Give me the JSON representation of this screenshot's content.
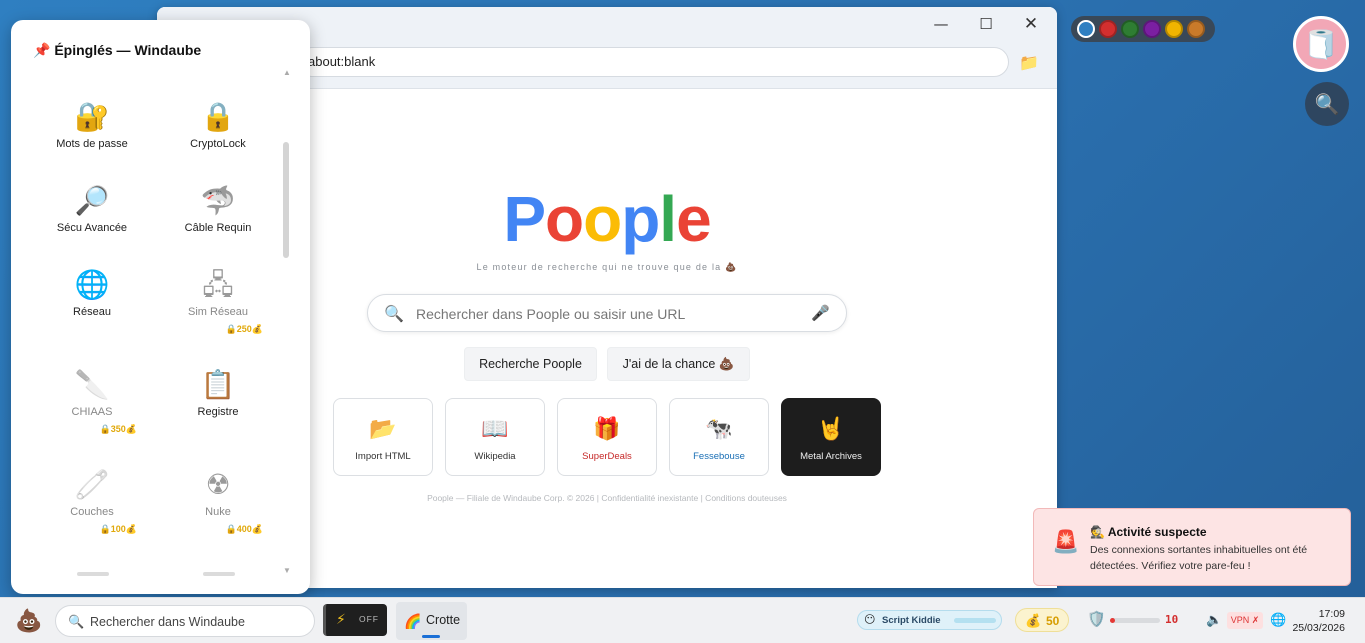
{
  "browser": {
    "address": "about:blank",
    "window_controls": {
      "minimize": "—",
      "maximize": "☐",
      "close": "✕"
    },
    "logo_letters": [
      "P",
      "o",
      "o",
      "p",
      "l",
      "e"
    ],
    "tagline": "Le moteur de recherche qui ne trouve que de la 💩",
    "search_placeholder": "Rechercher dans Poople ou saisir une URL",
    "buttons": {
      "search": "Recherche Poople",
      "lucky": "J'ai de la chance 💩"
    },
    "tiles": [
      {
        "label": "Import HTML",
        "icon": "📂",
        "icon_name": "folder-icon",
        "color": "#333333"
      },
      {
        "label": "Wikipedia",
        "icon": "📖",
        "icon_name": "book-icon",
        "color": "#333333"
      },
      {
        "label": "SuperDeals",
        "icon": "🎁",
        "icon_name": "gift-icon",
        "color": "#c62828"
      },
      {
        "label": "Fessebouse",
        "icon": "🐄",
        "icon_name": "cow-icon",
        "color": "#1a6fb5"
      },
      {
        "label": "Metal Archives",
        "icon": "🤘",
        "icon_name": "metal-hand-icon",
        "color": "#eeeeee"
      }
    ],
    "footer": "Poople — Filiale de Windaube Corp. © 2026 | Confidentialité inexistante | Conditions douteuses"
  },
  "pinned": {
    "title": "📌 Épinglés — Windaube",
    "apps": [
      {
        "label": "Mots de passe",
        "icon": "🔐",
        "icon_name": "lock-key-icon",
        "locked": false,
        "price": ""
      },
      {
        "label": "CryptoLock",
        "icon": "🔒",
        "icon_name": "padlock-icon",
        "locked": false,
        "price": ""
      },
      {
        "label": "Sécu Avancée",
        "icon": "🔎",
        "icon_name": "magnifier-icon",
        "locked": false,
        "price": ""
      },
      {
        "label": "Câble Requin",
        "icon": "🦈",
        "icon_name": "shark-icon",
        "locked": false,
        "price": ""
      },
      {
        "label": "Réseau",
        "icon": "🌐",
        "icon_name": "globe-icon",
        "locked": false,
        "price": ""
      },
      {
        "label": "Sim Réseau",
        "icon": "🖧",
        "icon_name": "network-icon",
        "locked": true,
        "price": "250"
      },
      {
        "label": "CHIAAS",
        "icon": "🔪",
        "icon_name": "knife-icon",
        "locked": true,
        "price": "350"
      },
      {
        "label": "Registre",
        "icon": "📋",
        "icon_name": "clipboard-icon",
        "locked": false,
        "price": ""
      },
      {
        "label": "Couches",
        "icon": "🧷",
        "icon_name": "safety-pin-icon",
        "locked": true,
        "price": "100"
      },
      {
        "label": "Nuke",
        "icon": "☢",
        "icon_name": "radioactive-icon",
        "locked": true,
        "price": "400"
      }
    ]
  },
  "palette": [
    "#2f7fc1",
    "#d32f2f",
    "#2e7d32",
    "#7b1fa2",
    "#f0b400",
    "#c97a2a"
  ],
  "toast": {
    "icon": "🚨",
    "title": "🕵️ Activité suspecte",
    "body": "Des connexions sortantes inhabituelles ont été détectées. Vérifiez votre pare-feu !"
  },
  "taskbar": {
    "start_icon": "💩",
    "search_placeholder": "Rechercher dans Windaube",
    "power_label": "OFF",
    "app_label": "Crotte",
    "rank": "Script Kiddie",
    "coins": "50",
    "threat_value": "10",
    "threat_fraction": 0.1,
    "vpn": "VPN ✗",
    "time": "17:09",
    "date": "25/03/2026"
  }
}
